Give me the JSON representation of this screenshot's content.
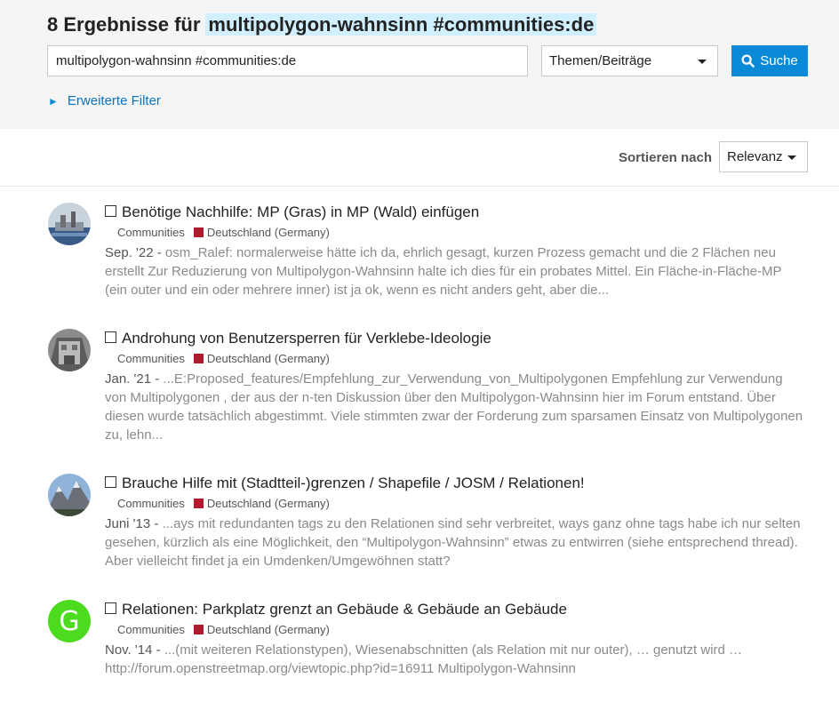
{
  "header": {
    "count_text": "8 Ergebnisse für",
    "term": "multipolygon-wahnsinn #communities:de"
  },
  "search": {
    "value": "multipolygon-wahnsinn #communities:de",
    "type_selected": "Themen/Beiträge",
    "button_label": "Suche"
  },
  "filter": {
    "advanced_label": "Erweiterte Filter"
  },
  "sort": {
    "label": "Sortieren nach",
    "selected": "Relevanz"
  },
  "results": [
    {
      "title": "Benötige Nachhilfe: MP (Gras) in MP (Wald) einfügen",
      "category_parent": "Communities",
      "category": "Deutschland (Germany)",
      "date": "Sep. '22 -",
      "blurb": " osm_Ralef: normalerweise hätte ich da, ehrlich gesagt, kurzen Prozess gemacht und die 2 Flächen neu erstellt Zur Reduzierung von Multipolygon-Wahnsinn halte ich dies für ein probates Mittel. Ein Fläche-in-Fläche-MP (ein outer und ein oder mehrere inner) ist ja ok, wenn es nicht anders geht, aber die...",
      "avatar_icon": "city-photo-avatar"
    },
    {
      "title": "Androhung von Benutzersperren für Verklebe-Ideologie",
      "category_parent": "Communities",
      "category": "Deutschland (Germany)",
      "date": "Jan. '21 -",
      "blurb": " ...E:Proposed_features/Empfehlung_zur_Verwendung_von_Multipolygonen Empfehlung zur Verwendung von Multipolygonen , der aus der n-ten Diskussion über den Multipolygon-Wahnsinn hier im Forum entstand. Über diesen wurde tatsächlich abgestimmt. Viele stimmten zwar der Forderung zum sparsamen Einsatz von Multipolygonen zu, lehn...",
      "avatar_icon": "building-photo-avatar"
    },
    {
      "title": "Brauche Hilfe mit (Stadtteil-)grenzen / Shapefile / JOSM / Relationen!",
      "category_parent": "Communities",
      "category": "Deutschland (Germany)",
      "date": "Juni '13 -",
      "blurb": " ...ays mit redundanten tags zu den Relationen sind sehr verbreitet, ways ganz ohne tags habe ich nur selten gesehen, kürzlich als eine Möglichkeit, den “Multipolygon-Wahnsinn” etwas zu entwirren (siehe entsprechend thread). Aber vielleicht findet ja ein Umdenken/Umgewöhnen statt?",
      "avatar_icon": "mountain-photo-avatar"
    },
    {
      "title": "Relationen: Parkplatz grenzt an Gebäude & Gebäude an Gebäude",
      "category_parent": "Communities",
      "category": "Deutschland (Germany)",
      "date": "Nov. '14 -",
      "blurb": " ...(mit weiteren Relationstypen), Wiesenabschnitten (als Relation mit nur outer), … genutzt wird … http://forum.openstreetmap.org/viewtopic.php?id=16911 Multipolygon-Wahnsinn",
      "avatar_letter": "G",
      "avatar_color": "#4cdb1e"
    }
  ]
}
